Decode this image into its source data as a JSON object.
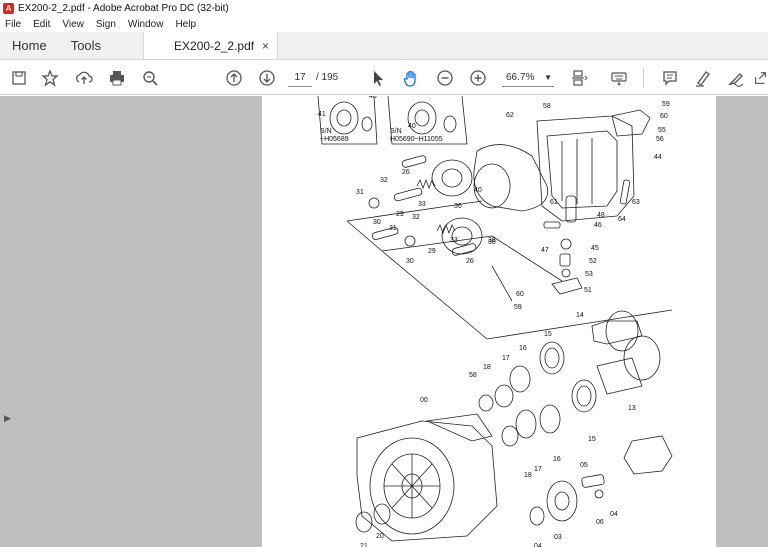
{
  "app": {
    "window_title": "EX200-2_2.pdf - Adobe Acrobat Pro DC (32-bit)"
  },
  "menu": [
    "File",
    "Edit",
    "View",
    "Sign",
    "Window",
    "Help"
  ],
  "tabs": {
    "home": "Home",
    "tools": "Tools",
    "document": "EX200-2_2.pdf",
    "close": "×"
  },
  "toolbar": {
    "page_current": "17",
    "page_total": "/ 195",
    "zoom": "66.7%"
  },
  "drawing": {
    "sn_left": "S/N",
    "sn_left_range": "~H05689",
    "sn_right": "S/N",
    "sn_right_range": "H05690~H11055",
    "labels": [
      "40",
      "41",
      "40",
      "58",
      "59",
      "60",
      "55",
      "56",
      "62",
      "44",
      "26",
      "32",
      "36",
      "40",
      "31",
      "29",
      "33",
      "36",
      "61",
      "48",
      "63",
      "64",
      "30",
      "32",
      "46",
      "31",
      "33",
      "47",
      "45",
      "36",
      "30",
      "29",
      "26",
      "52",
      "53",
      "60",
      "51",
      "59",
      "14",
      "15",
      "16",
      "17",
      "58",
      "18",
      "00",
      "13",
      "15",
      "16",
      "17",
      "18",
      "05",
      "20",
      "21",
      "03",
      "04",
      "06",
      "04"
    ]
  }
}
